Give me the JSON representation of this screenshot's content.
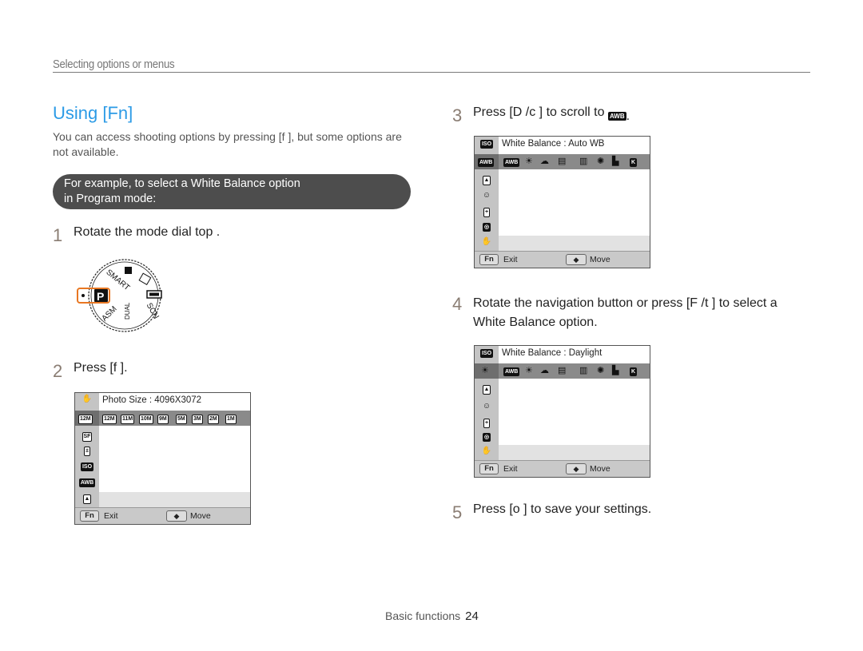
{
  "header": {
    "section": "Selecting options or menus"
  },
  "title": "Using [Fn]",
  "intro": "You can access shooting options by pressing [f   ], but some options are not available.",
  "example_bar": {
    "line1": "For example, to select a White Balance option",
    "line2": "in Program mode:"
  },
  "steps": [
    {
      "num": "1",
      "text": "Rotate the mode dial top ."
    },
    {
      "num": "2",
      "text": "Press [f   ]."
    },
    {
      "num": "3",
      "text": "Press [D      /c  ] to scroll to",
      "icon": "AWB"
    },
    {
      "num": "4",
      "text": "Rotate the navigation button or press [F /t    ] to select a White Balance option."
    },
    {
      "num": "5",
      "text": "Press [o    ] to save your settings."
    }
  ],
  "mode_dial": {
    "selected": "P",
    "labels": [
      "SMART",
      "ASM",
      "DUAL",
      "SCN",
      "P"
    ],
    "highlight_color": "#e87722"
  },
  "screens": {
    "photo_size": {
      "caption": "Photo Size : 4096X3072",
      "selected_icon": "12M",
      "options": [
        "12M",
        "11M",
        "10M",
        "9M",
        "5M",
        "3M",
        "2M",
        "1M"
      ],
      "side_icons": [
        "ois-hand-icon",
        "photo-size-icon",
        "quality-icon",
        "exposure-icon",
        "iso-icon",
        "white-balance-icon",
        "photo-style-icon"
      ],
      "exit_key": "Fn",
      "exit_label": "Exit",
      "move_label": "Move"
    },
    "wb_auto": {
      "caption": "White Balance : Auto WB",
      "selected_icon": "AWB",
      "options": [
        "AWB",
        "daylight",
        "cloudy",
        "fluorescent-H",
        "fluorescent-L",
        "tungsten",
        "custom",
        "K"
      ],
      "side_icons": [
        "iso-icon",
        "white-balance-icon",
        "photo-style-icon",
        "face-detect-off-icon",
        "af-area-icon",
        "metering-icon",
        "ois-hand-icon"
      ],
      "exit_key": "Fn",
      "exit_label": "Exit",
      "move_label": "Move"
    },
    "wb_daylight": {
      "caption": "White Balance : Daylight",
      "selected_icon": "daylight",
      "options": [
        "AWB",
        "daylight",
        "cloudy",
        "fluorescent-H",
        "fluorescent-L",
        "tungsten",
        "custom",
        "K"
      ],
      "side_icons": [
        "iso-icon",
        "white-balance-icon",
        "photo-style-icon",
        "face-detect-off-icon",
        "af-area-icon",
        "metering-icon",
        "ois-hand-icon"
      ],
      "exit_key": "Fn",
      "exit_label": "Exit",
      "move_label": "Move"
    }
  },
  "footer": {
    "section": "Basic functions",
    "page": "24"
  },
  "colors": {
    "title": "#2c9be6",
    "example_bar": "#4d4d4d",
    "step_number": "#8a7d73",
    "dial_highlight": "#e87722"
  }
}
